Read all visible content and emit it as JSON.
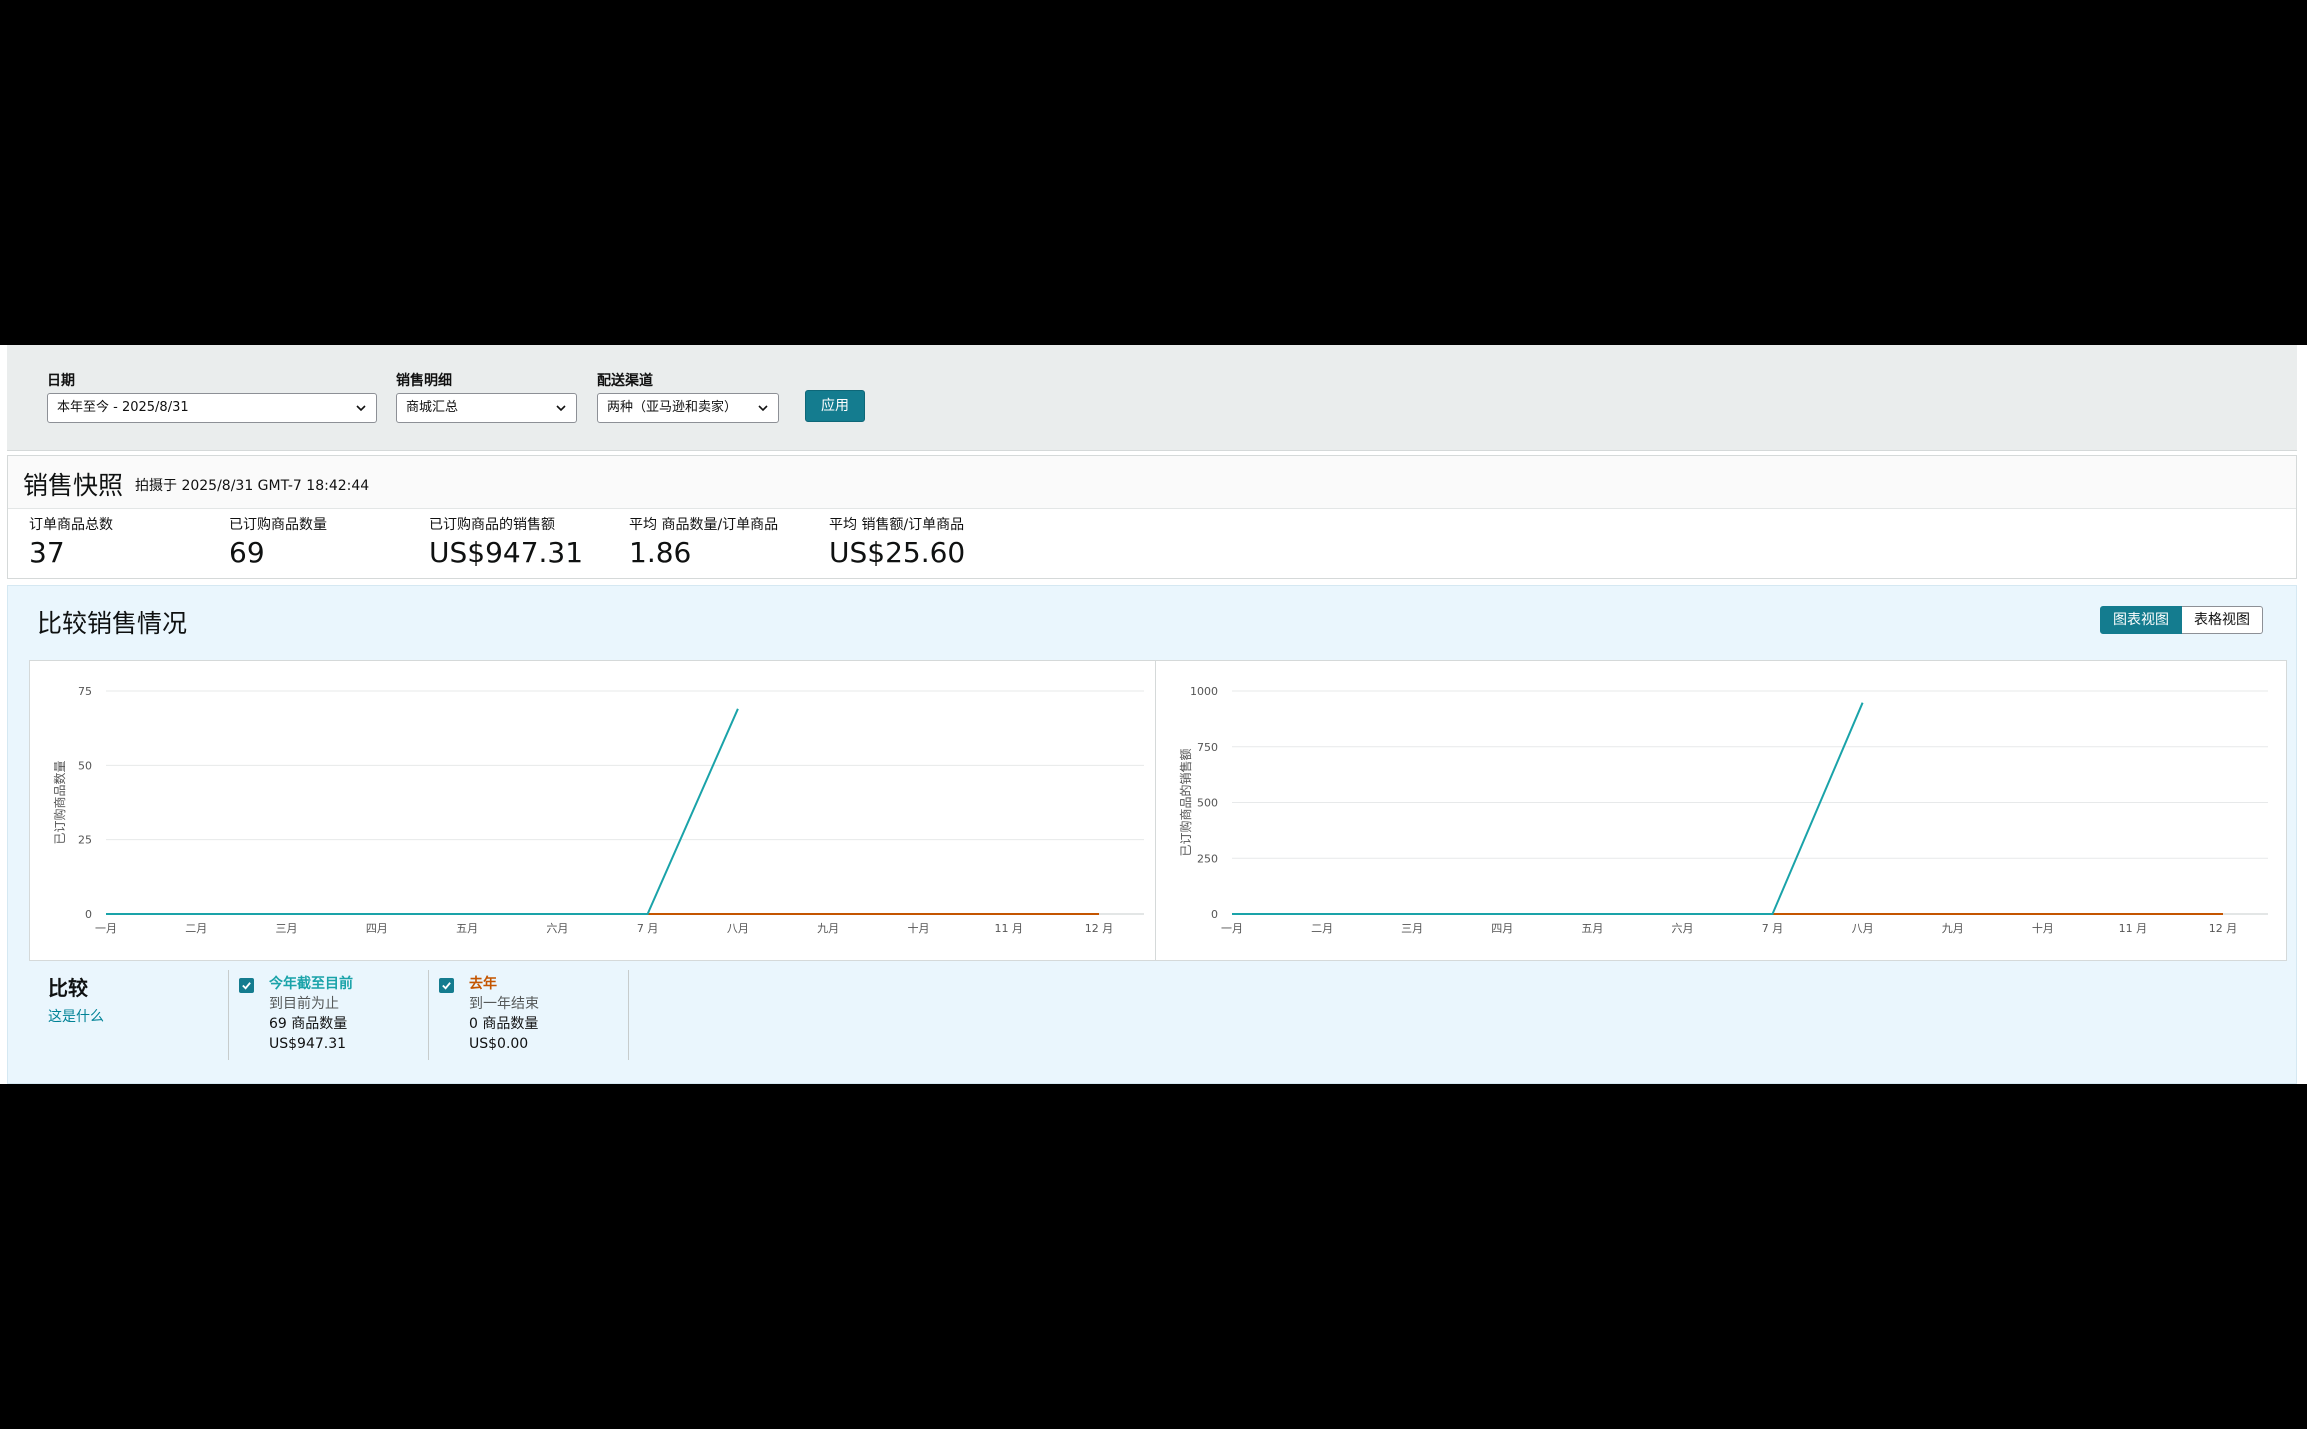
{
  "filters": {
    "date": {
      "label": "日期",
      "value": "本年至今 - 2025/8/31"
    },
    "sales_detail": {
      "label": "销售明细",
      "value": "商城汇总"
    },
    "channel": {
      "label": "配送渠道",
      "value": "两种（亚马逊和卖家）"
    },
    "apply_label": "应用"
  },
  "snapshot": {
    "title": "销售快照",
    "timestamp": "拍摄于 2025/8/31 GMT-7 18:42:44",
    "metrics": [
      {
        "label": "订单商品总数",
        "value": "37"
      },
      {
        "label": "已订购商品数量",
        "value": "69"
      },
      {
        "label": "已订购商品的销售额",
        "value": "US$947.31"
      },
      {
        "label": "平均 商品数量/订单商品",
        "value": "1.86"
      },
      {
        "label": "平均 销售额/订单商品",
        "value": "US$25.60"
      }
    ]
  },
  "compare": {
    "title": "比较销售情况",
    "view_chart_label": "图表视图",
    "view_table_label": "表格视图",
    "legend_title": "比较",
    "legend_link": "这是什么",
    "legend": [
      {
        "name": "今年截至目前",
        "sub": "到目前为止",
        "quantity": "69 商品数量",
        "sales": "US$947.31",
        "color": "#1aa3a9"
      },
      {
        "name": "去年",
        "sub": "到一年结束",
        "quantity": "0 商品数量",
        "sales": "US$0.00",
        "color": "#c45500"
      }
    ]
  },
  "chart_data": [
    {
      "type": "line",
      "ylabel": "已订购商品数量",
      "categories": [
        "一月",
        "二月",
        "三月",
        "四月",
        "五月",
        "六月",
        "7 月",
        "八月",
        "九月",
        "十月",
        "11 月",
        "12 月"
      ],
      "ylim": [
        0,
        75
      ],
      "yticks": [
        0,
        25,
        50,
        75
      ],
      "series": [
        {
          "name": "今年截至目前",
          "color": "#1aa3a9",
          "values": [
            0,
            0,
            0,
            0,
            0,
            0,
            0,
            69,
            null,
            null,
            null,
            null
          ]
        },
        {
          "name": "去年",
          "color": "#c45500",
          "values": [
            0,
            0,
            0,
            0,
            0,
            0,
            0,
            0,
            0,
            0,
            0,
            0
          ]
        }
      ]
    },
    {
      "type": "line",
      "ylabel": "已订购商品的销售额",
      "categories": [
        "一月",
        "二月",
        "三月",
        "四月",
        "五月",
        "六月",
        "7 月",
        "八月",
        "九月",
        "十月",
        "11 月",
        "12 月"
      ],
      "ylim": [
        0,
        1000
      ],
      "yticks": [
        0,
        250,
        500,
        750,
        1000
      ],
      "series": [
        {
          "name": "今年截至目前",
          "color": "#1aa3a9",
          "values": [
            0,
            0,
            0,
            0,
            0,
            0,
            0,
            947.31,
            null,
            null,
            null,
            null
          ]
        },
        {
          "name": "去年",
          "color": "#c45500",
          "values": [
            0,
            0,
            0,
            0,
            0,
            0,
            0,
            0,
            0,
            0,
            0,
            0
          ]
        }
      ]
    }
  ]
}
